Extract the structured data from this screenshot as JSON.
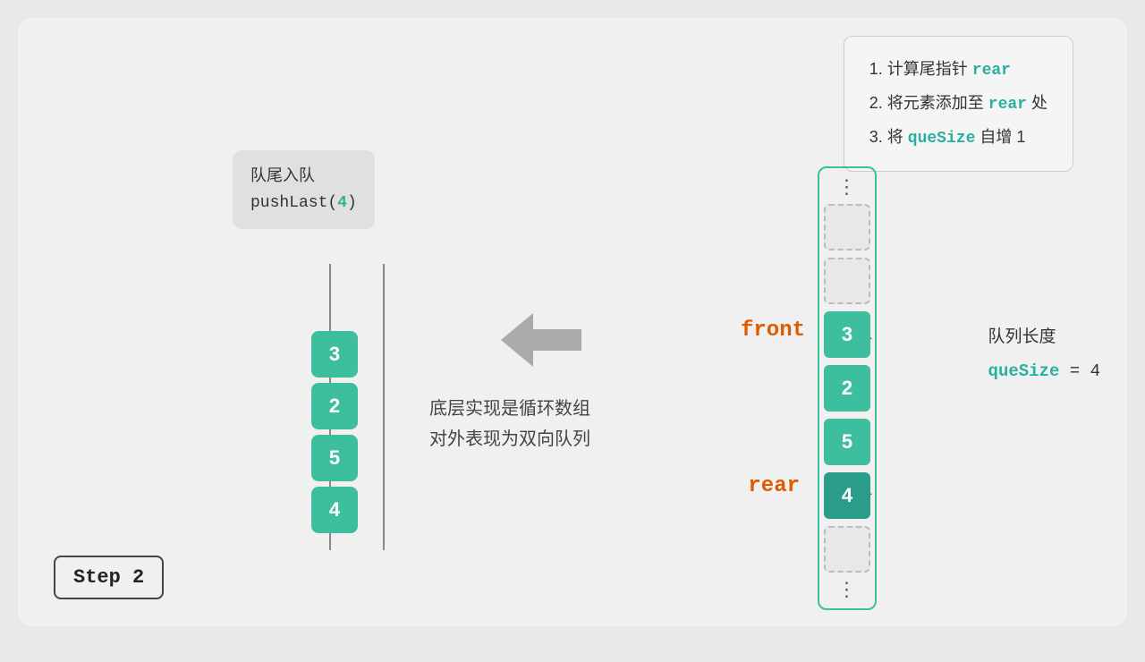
{
  "infoBox": {
    "line1_pre": "1. 计算尾指针 ",
    "line1_code": "rear",
    "line2_pre": "2. 将元素添加至 ",
    "line2_code": "rear",
    "line2_post": " 处",
    "line3_pre": "3. 将 ",
    "line3_code": "queSize",
    "line3_post": " 自增 1"
  },
  "stepBadge": "Step 2",
  "labelBox": {
    "line1": "队尾入队",
    "line2_pre": "pushLast(",
    "line2_num": "4",
    "line2_post": ")"
  },
  "leftStack": [
    {
      "value": "3"
    },
    {
      "value": "2"
    },
    {
      "value": "5"
    },
    {
      "value": "4"
    }
  ],
  "middleText": {
    "line1": "底层实现是循环数组",
    "line2": "对外表现为双向队列"
  },
  "rightArray": {
    "cells": [
      {
        "filled": false,
        "value": ""
      },
      {
        "filled": false,
        "value": ""
      },
      {
        "filled": true,
        "value": "3",
        "dark": false
      },
      {
        "filled": true,
        "value": "2",
        "dark": false
      },
      {
        "filled": true,
        "value": "5",
        "dark": false
      },
      {
        "filled": true,
        "value": "4",
        "dark": true
      },
      {
        "filled": false,
        "value": ""
      }
    ]
  },
  "labels": {
    "front": "front",
    "frontArrow": "▶",
    "rear": "rear",
    "rearArrow": "▶"
  },
  "queueInfo": {
    "label": "队列长度",
    "codeName": "queSize",
    "equals": " = ",
    "value": "4"
  },
  "arrow": {
    "direction": "left"
  }
}
